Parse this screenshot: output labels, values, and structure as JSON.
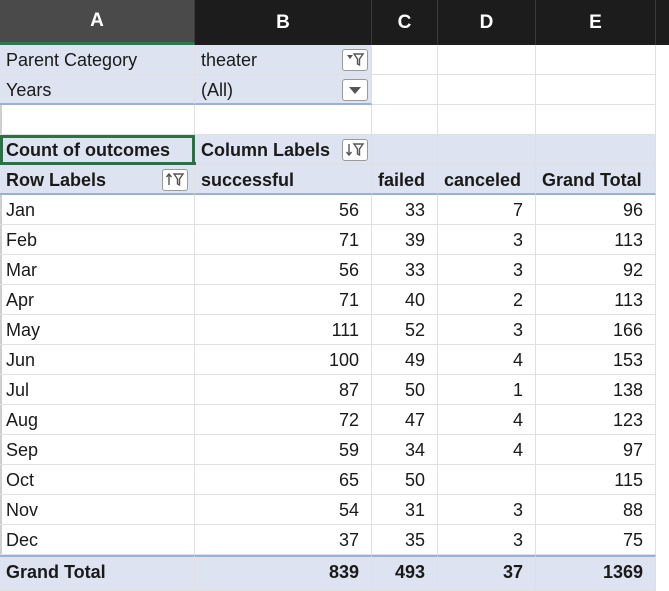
{
  "columns": [
    "A",
    "B",
    "C",
    "D",
    "E"
  ],
  "filters": [
    {
      "label": "Parent Category",
      "value": "theater",
      "icon": "filter-applied-icon"
    },
    {
      "label": "Years",
      "value": "(All)",
      "icon": "dropdown-arrow-icon"
    }
  ],
  "pivot": {
    "value_label": "Count of outcomes",
    "column_labels": "Column Labels",
    "row_labels": "Row Labels",
    "headers": [
      "successful",
      "failed",
      "canceled",
      "Grand Total"
    ],
    "rows": [
      {
        "label": "Jan",
        "successful": "56",
        "failed": "33",
        "canceled": "7",
        "total": "96"
      },
      {
        "label": "Feb",
        "successful": "71",
        "failed": "39",
        "canceled": "3",
        "total": "113"
      },
      {
        "label": "Mar",
        "successful": "56",
        "failed": "33",
        "canceled": "3",
        "total": "92"
      },
      {
        "label": "Apr",
        "successful": "71",
        "failed": "40",
        "canceled": "2",
        "total": "113"
      },
      {
        "label": "May",
        "successful": "111",
        "failed": "52",
        "canceled": "3",
        "total": "166"
      },
      {
        "label": "Jun",
        "successful": "100",
        "failed": "49",
        "canceled": "4",
        "total": "153"
      },
      {
        "label": "Jul",
        "successful": "87",
        "failed": "50",
        "canceled": "1",
        "total": "138"
      },
      {
        "label": "Aug",
        "successful": "72",
        "failed": "47",
        "canceled": "4",
        "total": "123"
      },
      {
        "label": "Sep",
        "successful": "59",
        "failed": "34",
        "canceled": "4",
        "total": "97"
      },
      {
        "label": "Oct",
        "successful": "65",
        "failed": "50",
        "canceled": "",
        "total": "115"
      },
      {
        "label": "Nov",
        "successful": "54",
        "failed": "31",
        "canceled": "3",
        "total": "88"
      },
      {
        "label": "Dec",
        "successful": "37",
        "failed": "35",
        "canceled": "3",
        "total": "75"
      }
    ],
    "grand_total": {
      "label": "Grand Total",
      "successful": "839",
      "failed": "493",
      "canceled": "37",
      "total": "1369"
    }
  },
  "colors": {
    "header_bar": "#1c1c1c",
    "pivot_blue": "#dde3f1",
    "selection": "#2f6f45"
  }
}
